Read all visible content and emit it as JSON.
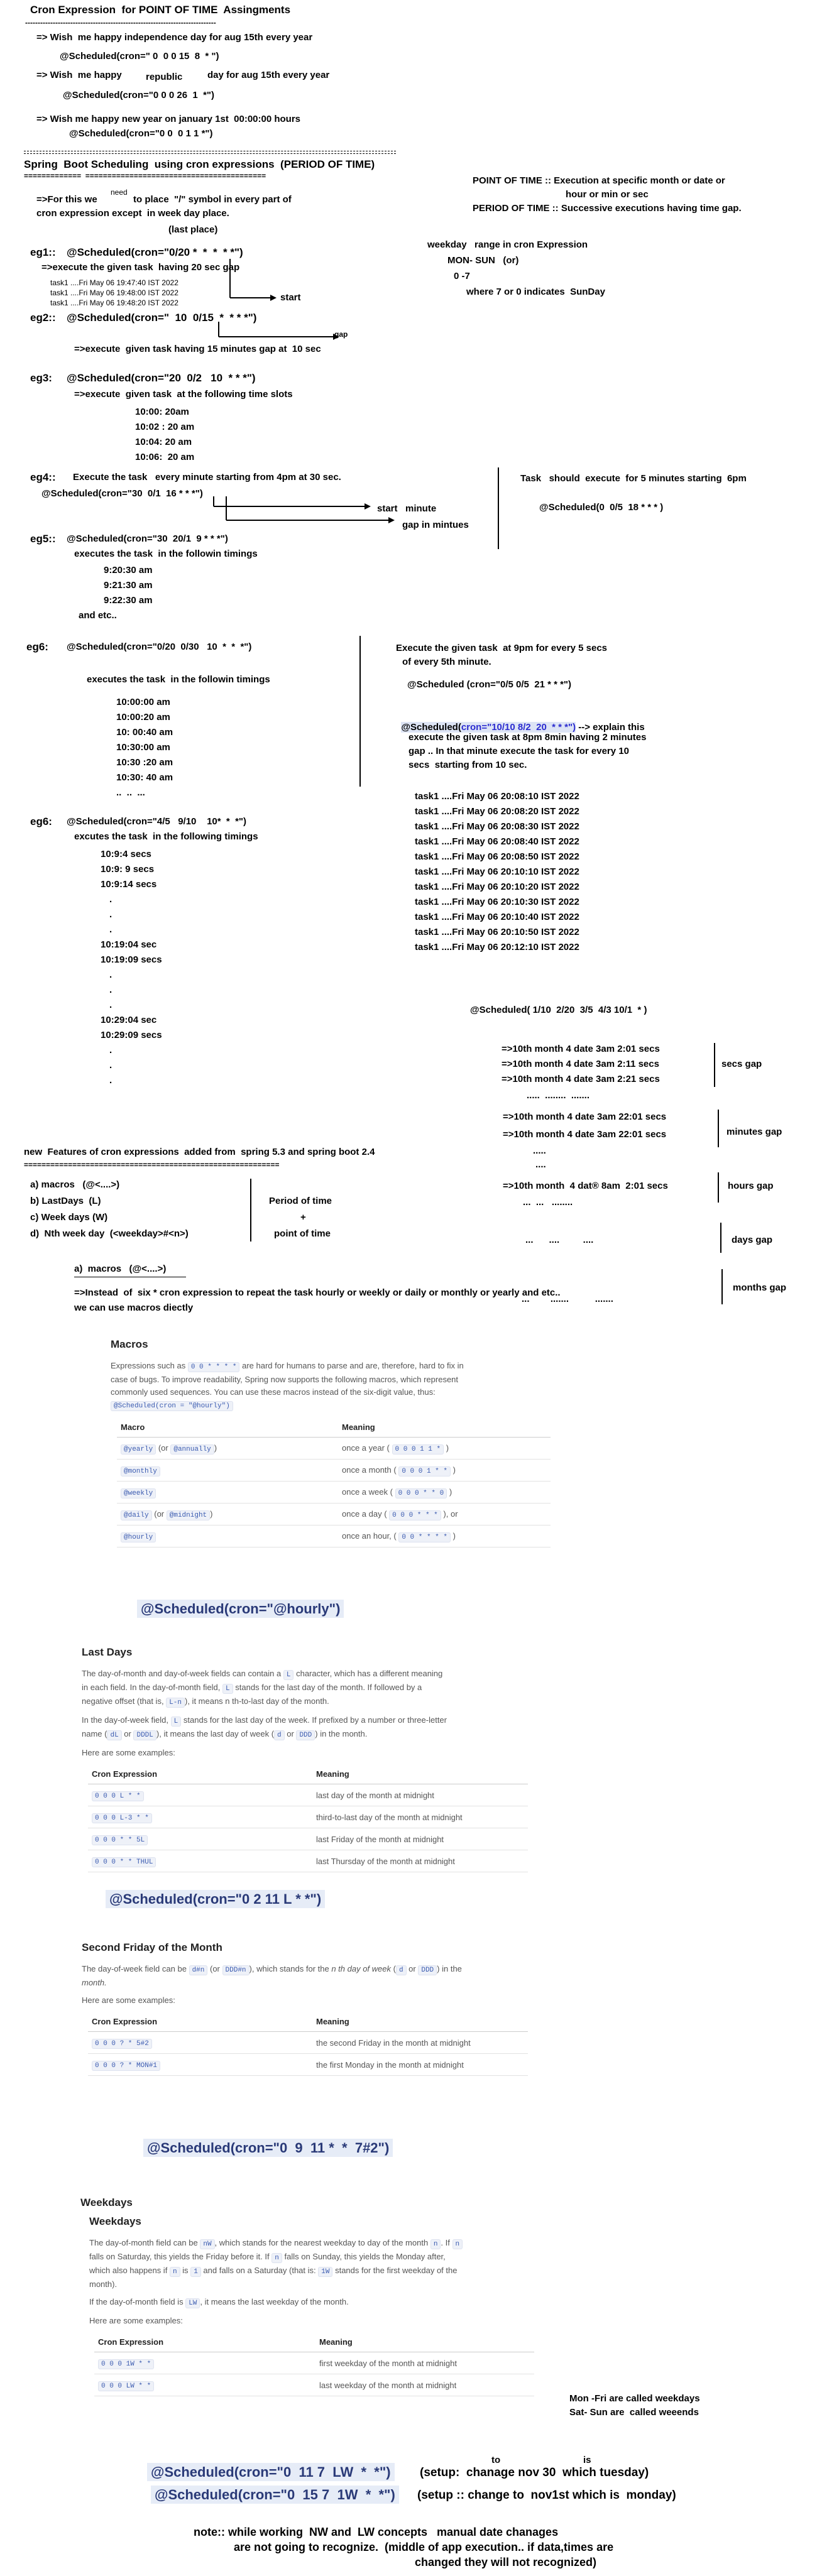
{
  "header": {
    "title": "Cron Expression  for POINT OF TIME  Assingments",
    "dashes": "----------------------------------------------------------------------------",
    "l1": "=> Wish  me happy independence day for aug 15th every year",
    "l2": "@Scheduled(cron=\" 0  0 0 15  8  * \")",
    "l3a": "=> Wish  me happy",
    "l3b": "republic",
    "l3c": "day for aug 15th every year",
    "l4": "@Scheduled(cron=\"0 0 0 26  1  *\")",
    "l5": "=> Wish me happy new year on january 1st  00:00:00 hours",
    "l6": "@Scheduled(cron=\"0 0  0 1 1 *\")"
  },
  "section1": {
    "title": "Spring  Boot Scheduling  using cron expressions  (PERIOD OF TIME)",
    "underline": "=============  =========================================",
    "for_this_a": "=>For this we",
    "need": "need",
    "for_this_b": "to place  \"/\" symbol in every part of",
    "for_this_c": "cron expression except  in week day place.",
    "last_place": "(last place)",
    "pot": "POINT OF TIME :: Execution at specific month or date or",
    "pot2": "hour or min or sec",
    "pot3": "PERIOD OF TIME :: Successive executions having time gap.",
    "weekday1": "weekday   range in cron Expression",
    "weekday2": "MON- SUN   (or)",
    "weekday3": "0 -7",
    "weekday4": "where 7 or 0 indicates  SunDay"
  },
  "eg1": {
    "label": "eg1::",
    "code": "@Scheduled(cron=\"0/20 *  *  *  * *\")",
    "desc": "=>execute the given task  having 20 sec gap",
    "log1": "task1 ....Fri May 06 19:47:40 IST 2022",
    "log2": "task1 ....Fri May 06 19:48:00 IST 2022",
    "log3": "task1 ....Fri May 06 19:48:20 IST 2022",
    "start": "start"
  },
  "eg2": {
    "label": "eg2::",
    "code": "@Scheduled(cron=\"  10  0/15  *  * * *\")",
    "gap": "gap",
    "desc": "=>execute  given task having 15 minutes gap at  10 sec"
  },
  "eg3": {
    "label": "eg3:",
    "code": "@Scheduled(cron=\"20  0/2   10  * * *\")",
    "desc": "=>execute  given task  at the following time slots",
    "times": [
      "10:00: 20am",
      "10:02 : 20 am",
      "10:04: 20 am",
      "10:06:  20 am"
    ]
  },
  "eg4": {
    "label": "eg4::",
    "desc": "Execute the task   every minute starting from 4pm at 30 sec.",
    "code": "@Scheduled(cron=\"30  0/1  16 * * *\")",
    "start_minute": "start   minute",
    "gap_minutes": "gap in mintues"
  },
  "task6pm": {
    "desc": "Task   should  execute  for 5 minutes starting  6pm",
    "code": "@Scheduled(0  0/5  18 * * * )"
  },
  "eg5": {
    "label": "eg5::",
    "code": "@Scheduled(cron=\"30  20/1  9 * * *\")",
    "desc": "executes the task  in the followin timings",
    "times": [
      "9:20:30 am",
      "9:21:30 am",
      "9:22:30 am",
      "and etc.."
    ]
  },
  "eg6a": {
    "label": "eg6:",
    "code": "@Scheduled(cron=\"0/20  0/30   10  *  *  *\")",
    "desc": "executes the task  in the followin timings",
    "times": [
      "10:00:00 am",
      "10:00:20 am",
      "10: 00:40 am",
      "10:30:00 am",
      "10:30 :20 am",
      "10:30: 40 am",
      "..  ..  ..."
    ]
  },
  "eg9pm": {
    "desc1": "Execute the given task  at 9pm for every 5 secs",
    "desc2": "of every 5th minute.",
    "code": "@Scheduled (cron=\"0/5 0/5  21 * * *\")",
    "explain_a": "@Scheduled(",
    "explain_b": "cron=\"10/10 8/2  20  * * *\")",
    "explain_c": "--> explain this",
    "d1": "execute the given task at 8pm 8min having 2 minutes",
    "d2": "gap .. In that minute execute the task for every 10",
    "d3": "secs  starting from 10 sec.",
    "logs": [
      "task1 ....Fri May 06 20:08:10 IST 2022",
      "task1 ....Fri May 06 20:08:20 IST 2022",
      "task1 ....Fri May 06 20:08:30 IST 2022",
      "task1 ....Fri May 06 20:08:40 IST 2022",
      "task1 ....Fri May 06 20:08:50 IST 2022",
      "task1 ....Fri May 06 20:10:10 IST 2022",
      "task1 ....Fri May 06 20:10:20 IST 2022",
      "task1 ....Fri May 06 20:10:30 IST 2022",
      "task1 ....Fri May 06 20:10:40 IST 2022",
      "task1 ....Fri May 06 20:10:50 IST 2022",
      "task1 ....Fri May 06 20:12:10 IST 2022"
    ]
  },
  "eg6b": {
    "label": "eg6:",
    "code": "@Scheduled(cron=\"4/5   9/10    10*  *  *\")",
    "desc": "excutes the task  in the following timings",
    "times": [
      "10:9:4 secs",
      "10:9: 9 secs",
      "10:9:14 secs",
      ".",
      ".",
      ".",
      "10:19:04 sec",
      "10:19:09 secs",
      ".",
      ".",
      ".",
      "10:29:04 sec",
      "10:29:09 secs",
      ".",
      ".",
      "."
    ]
  },
  "gaps": {
    "code": "@Scheduled( 1/10  2/20  3/5  4/3 10/1  * )",
    "secs": [
      "=>10th month 4 date 3am 2:01 secs",
      "=>10th month 4 date 3am 2:11 secs",
      "=>10th month 4 date 3am 2:21 secs"
    ],
    "secs_dots": ".....  ........  .......",
    "secs_label": "secs gap",
    "mins": [
      "=>10th month 4 date 3am 22:01 secs",
      "=>10th month 4 date 3am 22:01 secs"
    ],
    "mins_dots1": ".....",
    "mins_dots2": "....",
    "mins_label": "minutes gap",
    "hours": "=>10th month  4 dat® 8am  2:01 secs",
    "hours_dots": "...  ...   ........",
    "hours_label": "hours gap",
    "days_dots": "...      ....         ....",
    "days_label": "days gap",
    "months_dots": "...        .......          .......",
    "months_label": "months gap"
  },
  "features": {
    "title": "new  Features of cron expressions  added from  spring 5.3 and spring boot 2.4",
    "rule": "==========================================================",
    "items": [
      "a) macros   (@<....>)",
      "b) LastDays  (L)",
      "c) Week days (W)",
      "d)  Nth week day  (<weekday>#<n>)"
    ],
    "period1": "Period of time",
    "period2": "+",
    "period3": "point of time",
    "macros_head": "a)  macros   (@<....>)",
    "instead1": "=>Instead  of  six * cron expression to repeat the task hourly or weekly or daily or monthly or yearly and etc..",
    "instead2": "we can use macros diectly"
  },
  "macros": {
    "title": "Macros",
    "p1a": "Expressions such as",
    "p1code": "0 0 * * * *",
    "p1b": "are hard for humans to parse and are, therefore, hard to fix in",
    "p1c": "case of bugs. To improve readability, Spring now supports the following macros, which represent",
    "p1d": "commonly used sequences. You can use these macros instead of the six-digit value, thus:",
    "p1code2": "@Scheduled(cron = \"@hourly\")",
    "th1": "Macro",
    "th2": "Meaning",
    "rows": [
      {
        "m": "@yearly",
        "or": "(or",
        "m2": "@annually",
        "close": ")",
        "meaning": "once a year (",
        "code": "0 0 0 1 1 *",
        "end": ")"
      },
      {
        "m": "@monthly",
        "or": "",
        "m2": "",
        "close": "",
        "meaning": "once a month (",
        "code": "0 0 0 1 * *",
        "end": ")"
      },
      {
        "m": "@weekly",
        "or": "",
        "m2": "",
        "close": "",
        "meaning": "once a week (",
        "code": "0 0 0 * * 0",
        "end": ")"
      },
      {
        "m": "@daily",
        "or": "(or",
        "m2": "@midnight",
        "close": ")",
        "meaning": "once a day (",
        "code": "0 0 0 * * *",
        "end": "), or"
      },
      {
        "m": "@hourly",
        "or": "",
        "m2": "",
        "close": "",
        "meaning": "once an hour, (",
        "code": "0 0 * * * *",
        "end": ")"
      }
    ],
    "big": "@Scheduled(cron=\"@hourly\")"
  },
  "lastdays": {
    "title": "Last Days",
    "p1": "The day-of-month and day-of-week fields can contain a",
    "p1code": "L",
    "p1b": "character, which has a different meaning",
    "p2": "in each field. In the day-of-month field,",
    "p2b": "stands for the last day of the month. If followed by a",
    "p3": "negative offset (that is,",
    "p3code": "L-n",
    "p3b": "), it means  n th-to-last day of the month.",
    "p4": "In the day-of-week field,",
    "p4b": "stands for the last day of the week. If prefixed by a number or three-letter",
    "p5": "name (",
    "p5c1": "dL",
    "p5or": "or",
    "p5c2": "DDDL",
    "p5b": "), it means the last day of week (",
    "p5c3": "d",
    "p5c4": "DDD",
    "p5e": ") in the month.",
    "here": "Here are some examples:",
    "th1": "Cron Expression",
    "th2": "Meaning",
    "rows": [
      {
        "c": "0 0 0 L * *",
        "m": "last day of the month at midnight"
      },
      {
        "c": "0 0 0 L-3 * *",
        "m": "third-to-last day of the month at midnight"
      },
      {
        "c": "0 0 0 * * 5L",
        "m": "last Friday of the month at midnight"
      },
      {
        "c": "0 0 0 * * THUL",
        "m": "last Thursday of the month at midnight"
      }
    ],
    "big": "@Scheduled(cron=\"0 2 11 L * *\")"
  },
  "secondfriday": {
    "title": "Second Friday of the Month",
    "p1a": "The day-of-week field can be",
    "p1c1": "d#n",
    "p1or": "(or",
    "p1c2": "DDD#n",
    "p1b": "), which stands for the",
    "p1em": "n th day of week",
    "p1c3": "d",
    "p1c4": "DDD",
    "p1e": ") in the",
    "p2": "month.",
    "here": "Here are some examples:",
    "th1": "Cron Expression",
    "th2": "Meaning",
    "rows": [
      {
        "c": "0 0 0 ? * 5#2",
        "m": "the second Friday in the month at midnight"
      },
      {
        "c": "0 0 0 ? * MON#1",
        "m": "the first Monday in the month at midnight"
      }
    ],
    "big": "@Scheduled(cron=\"0  9  11 *  *  7#2\")"
  },
  "weekdays": {
    "title1": "Weekdays",
    "title2": "Weekdays",
    "p1": "The day-of-month field can be",
    "p1c": "nW",
    "p1b": ", which stands for the nearest weekday to day of the month",
    "p1c2": "n",
    "p1e": ". If",
    "p1c3": "n",
    "p2": "falls on Saturday, this yields the Friday before it. If",
    "p2c": "n",
    "p2b": "falls on Sunday, this yields the Monday after,",
    "p3": "which also happens if",
    "p3c": "n",
    "p3b": "is",
    "p3c2": "1",
    "p3e": "and falls on a Saturday (that is:",
    "p3c3": "1W",
    "p3f": "stands for the first weekday of the",
    "p4": "month).",
    "p5": "If the day-of-month field is",
    "p5c": "LW",
    "p5b": ", it means the last weekday of the month.",
    "here": "Here are some examples:",
    "th1": "Cron Expression",
    "th2": "Meaning",
    "rows": [
      {
        "c": "0 0 0 1W * *",
        "m": "first weekday of the month at midnight"
      },
      {
        "c": "0 0 0 LW * *",
        "m": "last weekday of the month at midnight"
      }
    ],
    "note1": "Mon -Fri are called weekdays",
    "note2": "Sat- Sun are  called weeends",
    "big1": "@Scheduled(cron=\"0  11 7  LW  *  *\")",
    "big1b": "(setup:  chanage nov 30  which tuesday)",
    "to": "to",
    "is": "is",
    "big2": "@Scheduled(cron=\"0  15 7  1W  *  *\")",
    "big2b": "(setup :: change to  nov1st which is  monday)"
  },
  "note": {
    "l1": "note:: while working  NW and  LW concepts   manual date chanages",
    "l2": "are not going to recognize.  (middle of app execution.. if data,times are",
    "l3": "changed they will not recognized)"
  }
}
